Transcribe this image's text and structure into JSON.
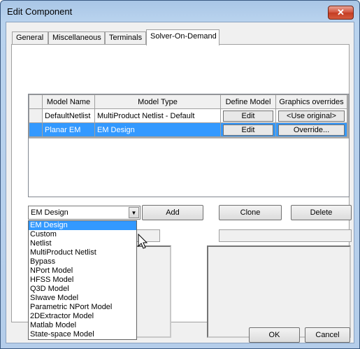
{
  "window": {
    "title": "Edit Component",
    "close_glyph": "✕"
  },
  "tabs": [
    {
      "label": "General",
      "active": false
    },
    {
      "label": "Miscellaneous",
      "active": false
    },
    {
      "label": "Terminals",
      "active": false
    },
    {
      "label": "Solver-On-Demand",
      "active": true
    }
  ],
  "model_table": {
    "headers": [
      "Model Name",
      "Model Type",
      "Define Model",
      "Graphics overrides"
    ],
    "rows": [
      {
        "name": "DefaultNetlist",
        "type": "MultiProduct Netlist - Default",
        "define": "Edit",
        "graphics": "<Use original>",
        "selected": false
      },
      {
        "name": "Planar EM",
        "type": "EM Design",
        "define": "Edit",
        "graphics": "Override...",
        "selected": true
      }
    ]
  },
  "model_type_combo": {
    "value": "EM Design",
    "options": [
      "EM Design",
      "Custom",
      "Netlist",
      "MultiProduct Netlist",
      "Bypass",
      "NPort Model",
      "HFSS Model",
      "Q3D Model",
      "SIwave Model",
      "Parametric NPort Model",
      "2DExtractor Model",
      "Matlab Model",
      "State-space Model"
    ],
    "selected_index": 0
  },
  "actions": {
    "add": "Add",
    "clone": "Clone",
    "delete": "Delete"
  },
  "footer": {
    "ok": "OK",
    "cancel": "Cancel"
  },
  "colors": {
    "selection": "#3399ff",
    "title_bar": "#b9d3ee",
    "close_button": "#c43d22"
  }
}
